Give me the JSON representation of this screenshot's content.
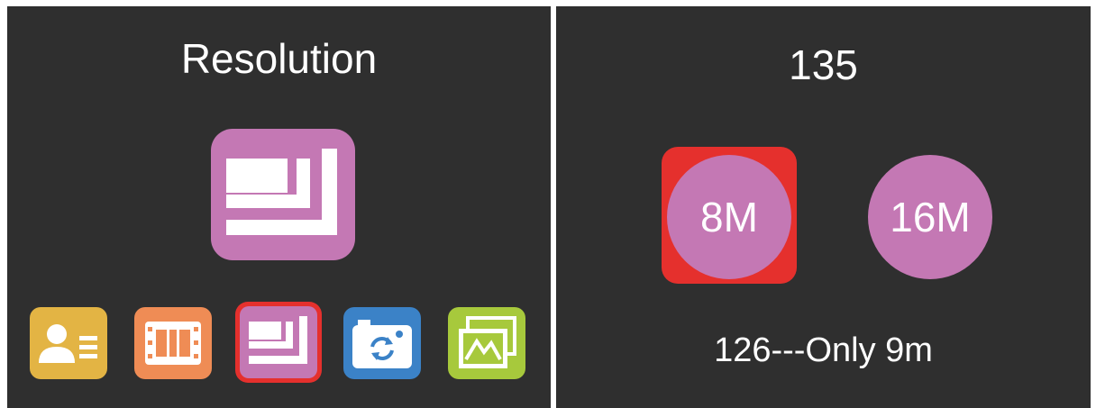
{
  "left_panel": {
    "title": "Resolution",
    "main_icon": "resolution-icon",
    "bottom_icons": [
      {
        "name": "user-profile-icon",
        "color": "#e3b444",
        "selected": false
      },
      {
        "name": "film-icon",
        "color": "#ef8c55",
        "selected": false
      },
      {
        "name": "resolution-icon",
        "color": "#c478b4",
        "selected": true
      },
      {
        "name": "camera-rotate-icon",
        "color": "#3b82c7",
        "selected": false
      },
      {
        "name": "gallery-icon",
        "color": "#a7c93c",
        "selected": false
      }
    ]
  },
  "right_panel": {
    "title": "135",
    "options": [
      {
        "label": "8M",
        "selected": true
      },
      {
        "label": "16M",
        "selected": false
      }
    ],
    "footer": "126---Only 9m"
  },
  "colors": {
    "background": "#2f2f2f",
    "accent_purple": "#c478b4",
    "selected_red": "#e5302d"
  }
}
